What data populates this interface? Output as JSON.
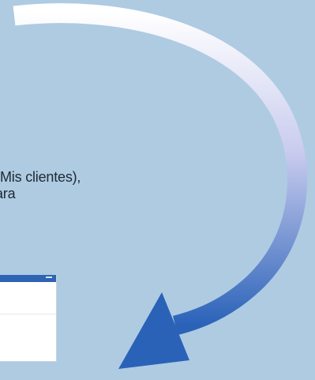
{
  "caption": {
    "line1": "Mis clientes),",
    "line2": "ara"
  },
  "colors": {
    "background": "#aecbe2",
    "arrow_start": "#ffffff",
    "arrow_end": "#2a62b8",
    "window_titlebar": "#2f63b3"
  },
  "icons": {
    "arrow": "curved-arrow-icon"
  }
}
